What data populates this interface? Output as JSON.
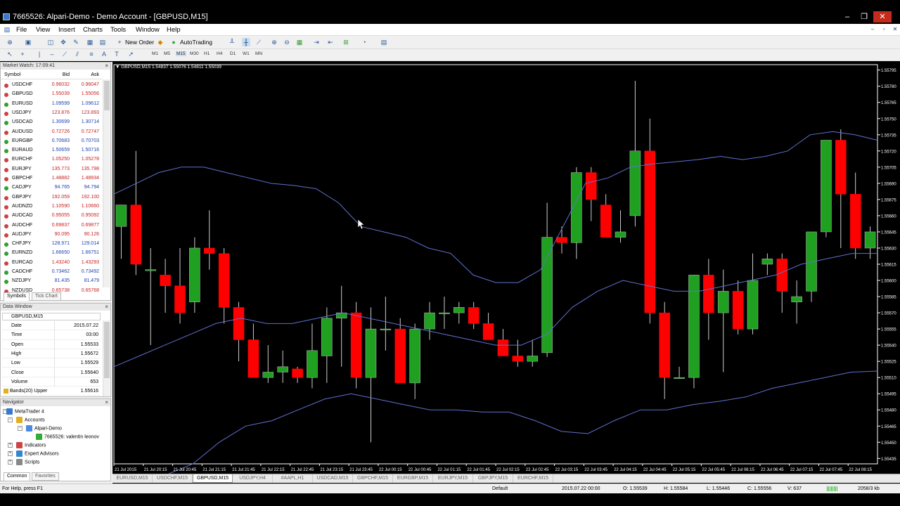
{
  "window": {
    "title": "7665526: Alpari-Demo - Demo Account - [GBPUSD,M15]",
    "controls": [
      "–",
      "❐",
      "✕"
    ]
  },
  "menu": [
    "File",
    "View",
    "Insert",
    "Charts",
    "Tools",
    "Window",
    "Help"
  ],
  "mdi_controls": [
    "–",
    "▫",
    "✕"
  ],
  "toolbar": {
    "new_order": "New Order",
    "autotrading": "AutoTrading",
    "timeframes": [
      "M1",
      "M5",
      "M15",
      "M30",
      "H1",
      "H4",
      "D1",
      "W1",
      "MN"
    ],
    "active_timeframe": "M15"
  },
  "market_watch": {
    "title": "Market Watch: 17:09:41",
    "columns": [
      "Symbol",
      "Bid",
      "Ask"
    ],
    "rows": [
      {
        "symbol": "USDCHF",
        "bid": "0.96032",
        "ask": "0.96047",
        "color": "#cc2020",
        "dot": "#d04040"
      },
      {
        "symbol": "GBPUSD",
        "bid": "1.55039",
        "ask": "1.55056",
        "color": "#cc2020",
        "dot": "#d04040"
      },
      {
        "symbol": "EURUSD",
        "bid": "1.09599",
        "ask": "1.09612",
        "color": "#1a3fb0",
        "dot": "#30a030"
      },
      {
        "symbol": "USDJPY",
        "bid": "123.876",
        "ask": "123.893",
        "color": "#cc2020",
        "dot": "#d04040"
      },
      {
        "symbol": "USDCAD",
        "bid": "1.30699",
        "ask": "1.30714",
        "color": "#1a3fb0",
        "dot": "#30a030"
      },
      {
        "symbol": "AUDUSD",
        "bid": "0.72726",
        "ask": "0.72747",
        "color": "#cc2020",
        "dot": "#d04040"
      },
      {
        "symbol": "EURGBP",
        "bid": "0.70683",
        "ask": "0.70703",
        "color": "#1a3fb0",
        "dot": "#30a030"
      },
      {
        "symbol": "EURAUD",
        "bid": "1.50659",
        "ask": "1.50716",
        "color": "#1a3fb0",
        "dot": "#30a030"
      },
      {
        "symbol": "EURCHF",
        "bid": "1.05250",
        "ask": "1.05278",
        "color": "#cc2020",
        "dot": "#d04040"
      },
      {
        "symbol": "EURJPY",
        "bid": "135.773",
        "ask": "135.798",
        "color": "#cc2020",
        "dot": "#d04040"
      },
      {
        "symbol": "GBPCHF",
        "bid": "1.48882",
        "ask": "1.48934",
        "color": "#cc2020",
        "dot": "#d04040"
      },
      {
        "symbol": "CADJPY",
        "bid": "94.765",
        "ask": "94.794",
        "color": "#1a3fb0",
        "dot": "#30a030"
      },
      {
        "symbol": "GBPJPY",
        "bid": "192.059",
        "ask": "192.100",
        "color": "#cc2020",
        "dot": "#d04040"
      },
      {
        "symbol": "AUDNZD",
        "bid": "1.10590",
        "ask": "1.10660",
        "color": "#cc2020",
        "dot": "#d04040"
      },
      {
        "symbol": "AUDCAD",
        "bid": "0.95055",
        "ask": "0.95092",
        "color": "#cc2020",
        "dot": "#d04040"
      },
      {
        "symbol": "AUDCHF",
        "bid": "0.69837",
        "ask": "0.69877",
        "color": "#cc2020",
        "dot": "#d04040"
      },
      {
        "symbol": "AUDJPY",
        "bid": "90.095",
        "ask": "90.126",
        "color": "#cc2020",
        "dot": "#d04040"
      },
      {
        "symbol": "CHFJPY",
        "bid": "128.971",
        "ask": "129.014",
        "color": "#1a3fb0",
        "dot": "#30a030"
      },
      {
        "symbol": "EURNZD",
        "bid": "1.66650",
        "ask": "1.66751",
        "color": "#1a3fb0",
        "dot": "#30a030"
      },
      {
        "symbol": "EURCAD",
        "bid": "1.43240",
        "ask": "1.43293",
        "color": "#cc2020",
        "dot": "#d04040"
      },
      {
        "symbol": "CADCHF",
        "bid": "0.73462",
        "ask": "0.73492",
        "color": "#1a3fb0",
        "dot": "#30a030"
      },
      {
        "symbol": "NZDJPY",
        "bid": "81.435",
        "ask": "81.479",
        "color": "#1a3fb0",
        "dot": "#30a030"
      },
      {
        "symbol": "NZDUSD",
        "bid": "0.65738",
        "ask": "0.65768",
        "color": "#cc2020",
        "dot": "#d04040"
      }
    ],
    "tabs": [
      "Symbols",
      "Tick Chart"
    ]
  },
  "data_window": {
    "title": "Data Window",
    "symbol": "GBPUSD,M15",
    "rows": [
      {
        "key": "Date",
        "value": "2015.07.22"
      },
      {
        "key": "Time",
        "value": "03:00"
      },
      {
        "key": "Open",
        "value": "1.55533"
      },
      {
        "key": "High",
        "value": "1.55672"
      },
      {
        "key": "Low",
        "value": "1.55529"
      },
      {
        "key": "Close",
        "value": "1.55640"
      },
      {
        "key": "Volume",
        "value": "653"
      },
      {
        "key": "Bands(20) Upper",
        "value": "1.55616"
      }
    ]
  },
  "navigator": {
    "title": "Navigator",
    "items": [
      "MetaTrader 4",
      "Accounts",
      "Alpari-Demo",
      "7665526: valentin leonov",
      "Indicators",
      "Expert Advisors",
      "Scripts"
    ],
    "tabs": [
      "Common",
      "Favorites"
    ]
  },
  "chart_header": "▼ GBPUSD,M15  1.54837 1.55076 1.54811 1.55039",
  "chart_data": {
    "type": "candlestick",
    "symbol": "GBPUSD,M15",
    "ohlc_header": [
      "1.54837",
      "1.55076",
      "1.54811",
      "1.55039"
    ],
    "y_ticks": [
      "1.55795",
      "1.55780",
      "1.55765",
      "1.55750",
      "1.55735",
      "1.55720",
      "1.55705",
      "1.55690",
      "1.55675",
      "1.55660",
      "1.55645",
      "1.55630",
      "1.55615",
      "1.55600",
      "1.55585",
      "1.55570",
      "1.55555",
      "1.55540",
      "1.55525",
      "1.55510",
      "1.55495",
      "1.55480",
      "1.55465",
      "1.55450",
      "1.55435"
    ],
    "ylim": [
      1.5543,
      1.558
    ],
    "x_ticks": [
      "21 Jul 2015",
      "21 Jul 20:15",
      "21 Jul 20:45",
      "21 Jul 21:15",
      "21 Jul 21:45",
      "21 Jul 22:15",
      "21 Jul 22:45",
      "21 Jul 23:15",
      "21 Jul 23:45",
      "22 Jul 00:15",
      "22 Jul 00:45",
      "22 Jul 01:15",
      "22 Jul 01:45",
      "22 Jul 02:15",
      "22 Jul 02:45",
      "22 Jul 03:15",
      "22 Jul 03:45",
      "22 Jul 04:15",
      "22 Jul 04:45",
      "22 Jul 05:15",
      "22 Jul 05:45",
      "22 Jul 06:15",
      "22 Jul 06:45",
      "22 Jul 07:15",
      "22 Jul 07:45",
      "22 Jul 08:15"
    ],
    "candles": [
      [
        1.5565,
        1.5567,
        1.5562,
        1.5567
      ],
      [
        1.5567,
        1.5572,
        1.55605,
        1.55615
      ],
      [
        1.5561,
        1.5563,
        1.5554,
        1.5561
      ],
      [
        1.55605,
        1.5562,
        1.5557,
        1.55595
      ],
      [
        1.55595,
        1.5563,
        1.5556,
        1.5557
      ],
      [
        1.5558,
        1.5564,
        1.5557,
        1.5563
      ],
      [
        1.5563,
        1.55665,
        1.5561,
        1.55625
      ],
      [
        1.55625,
        1.5563,
        1.5556,
        1.55575
      ],
      [
        1.55575,
        1.5558,
        1.55525,
        1.55545
      ],
      [
        1.55545,
        1.5556,
        1.5551,
        1.5551
      ],
      [
        1.5551,
        1.5554,
        1.55505,
        1.55515
      ],
      [
        1.55515,
        1.55535,
        1.55505,
        1.5552
      ],
      [
        1.55518,
        1.5552,
        1.55505,
        1.5551
      ],
      [
        1.5551,
        1.5556,
        1.555,
        1.55535
      ],
      [
        1.5553,
        1.55575,
        1.55505,
        1.55565
      ],
      [
        1.55565,
        1.55595,
        1.5552,
        1.5557
      ],
      [
        1.5557,
        1.5558,
        1.555,
        1.5551
      ],
      [
        1.5551,
        1.55575,
        1.5545,
        1.55555
      ],
      [
        1.55555,
        1.55585,
        1.55535,
        1.55555
      ],
      [
        1.55555,
        1.55565,
        1.5552,
        1.55505
      ],
      [
        1.55505,
        1.5556,
        1.5549,
        1.55555
      ],
      [
        1.55555,
        1.5558,
        1.55545,
        1.5557
      ],
      [
        1.5557,
        1.55585,
        1.55555,
        1.5557
      ],
      [
        1.5557,
        1.5558,
        1.5556,
        1.55575
      ],
      [
        1.55575,
        1.5558,
        1.55555,
        1.5556
      ],
      [
        1.5556,
        1.5557,
        1.55545,
        1.55545
      ],
      [
        1.55545,
        1.55555,
        1.5553,
        1.5553
      ],
      [
        1.5553,
        1.55545,
        1.5552,
        1.55525
      ],
      [
        1.55525,
        1.55545,
        1.5552,
        1.5553
      ],
      [
        1.55533,
        1.55672,
        1.55529,
        1.5564
      ],
      [
        1.5564,
        1.5565,
        1.55625,
        1.55635
      ],
      [
        1.55635,
        1.55705,
        1.5562,
        1.557
      ],
      [
        1.557,
        1.55705,
        1.55655,
        1.55675
      ],
      [
        1.5567,
        1.5568,
        1.5564,
        1.5564
      ],
      [
        1.5564,
        1.55665,
        1.55635,
        1.55645
      ],
      [
        1.5566,
        1.55785,
        1.5565,
        1.5572
      ],
      [
        1.5572,
        1.5575,
        1.5556,
        1.5557
      ],
      [
        1.5557,
        1.5558,
        1.5549,
        1.5551
      ],
      [
        1.5551,
        1.5552,
        1.5551,
        1.5551
      ],
      [
        1.5551,
        1.55605,
        1.555,
        1.55605
      ],
      [
        1.55605,
        1.5562,
        1.55545,
        1.5557
      ],
      [
        1.5557,
        1.5561,
        1.55515,
        1.5559
      ],
      [
        1.5559,
        1.556,
        1.5555,
        1.55555
      ],
      [
        1.55555,
        1.55625,
        1.5555,
        1.556
      ],
      [
        1.55615,
        1.55625,
        1.55605,
        1.5562
      ],
      [
        1.5562,
        1.55625,
        1.5557,
        1.5559
      ],
      [
        1.5558,
        1.556,
        1.5556,
        1.55585
      ],
      [
        1.5559,
        1.55645,
        1.5558,
        1.55645
      ],
      [
        1.55645,
        1.5572,
        1.5564,
        1.5573
      ],
      [
        1.5573,
        1.5574,
        1.5563,
        1.5568
      ],
      [
        1.5568,
        1.557,
        1.5562,
        1.5563
      ],
      [
        1.5563,
        1.5565,
        1.5562,
        1.55645
      ]
    ],
    "bands": {
      "upper": [
        1.5568,
        1.5569,
        1.557,
        1.55705,
        1.55705,
        1.557,
        1.55695,
        1.5569,
        1.55688,
        1.55685,
        1.55672,
        1.5565,
        1.55645,
        1.5564,
        1.5563,
        1.55625,
        1.55605,
        1.55598,
        1.55598,
        1.5561,
        1.5565,
        1.5569,
        1.55695,
        1.55705,
        1.55708,
        1.5571,
        1.55712,
        1.55715,
        1.55712,
        1.55715,
        1.5572,
        1.55735,
        1.55738,
        1.55735,
        1.5573
      ],
      "middle": [
        1.5552,
        1.5553,
        1.5554,
        1.5555,
        1.5556,
        1.55565,
        1.5556,
        1.5556,
        1.55565,
        1.5557,
        1.55565,
        1.5556,
        1.55555,
        1.5555,
        1.55545,
        1.5554,
        1.5554,
        1.5555,
        1.55575,
        1.5559,
        1.556,
        1.55595,
        1.5559,
        1.5559,
        1.55595,
        1.556,
        1.55605,
        1.55615,
        1.5562,
        1.55625,
        1.55625
      ],
      "lower": [
        1.554,
        1.5541,
        1.5542,
        1.5543,
        1.5545,
        1.55465,
        1.5547,
        1.5548,
        1.5549,
        1.55495,
        1.5549,
        1.55485,
        1.5548,
        1.5548,
        1.55478,
        1.55478,
        1.5547,
        1.5546,
        1.55458,
        1.5547,
        1.5548,
        1.5548,
        1.55485,
        1.55488,
        1.55492,
        1.555,
        1.55505,
        1.5551,
        1.55515,
        1.55516
      ]
    },
    "colors": {
      "bull": "#20a020",
      "bear": "#ff0000",
      "wick": "#cccccc",
      "bands": "#6070d0",
      "axis": "#ffffff"
    }
  },
  "chart_tabs": [
    "EURUSD,M15",
    "USDCHF,M15",
    "GBPUSD,M15",
    "USDJPY,H4",
    "#AAPL,H1",
    "USDCAD,M15",
    "GBPCHF,M15",
    "EURGBP,M15",
    "EURJPY,M15",
    "GBPJPY,M15",
    "EURCHF,M15"
  ],
  "active_chart_tab": "GBPUSD,M15",
  "status": {
    "help": "For Help, press F1",
    "profile": "Default",
    "datetime": "2015.07.22 00:00",
    "open": "O: 1.55539",
    "high": "H: 1.55584",
    "low": "L: 1.55446",
    "close": "C: 1.55556",
    "volume": "V: 637",
    "traffic": "2058/3 kb"
  }
}
